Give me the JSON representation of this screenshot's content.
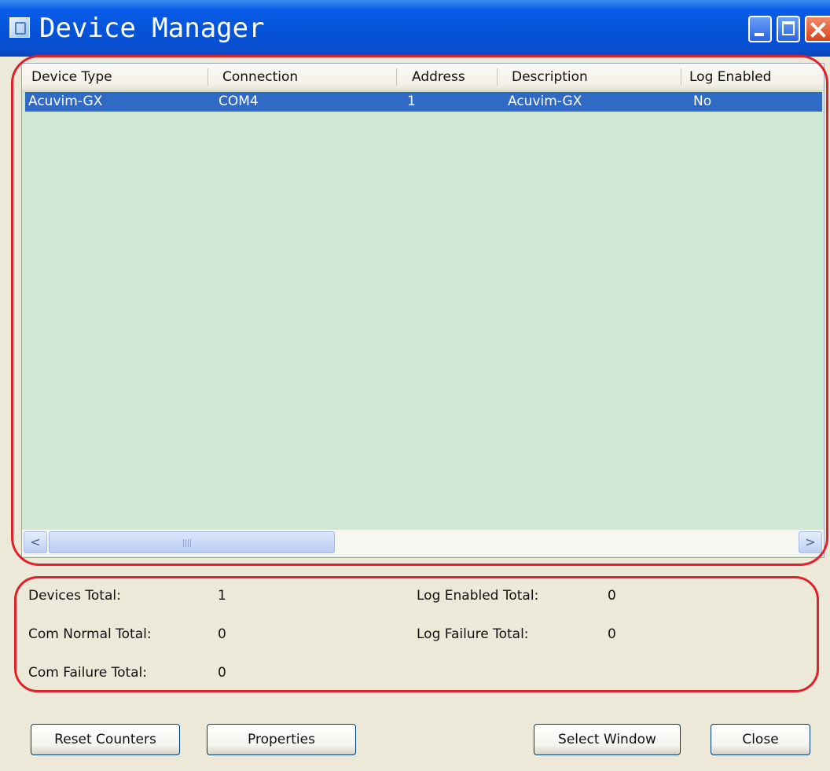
{
  "window": {
    "title": "Device Manager"
  },
  "device_list": {
    "columns": [
      "Device Type",
      "Connection",
      "Address",
      "Description",
      "Log Enabled"
    ],
    "rows": [
      [
        "Acuvim-GX",
        "COM4",
        "1",
        "Acuvim-GX",
        "No"
      ]
    ],
    "selected_row": 0,
    "scrollbar": {
      "left_arrow": "<",
      "right_arrow": ">"
    }
  },
  "stats": {
    "devices_total_label": "Devices Total:",
    "devices_total_value": "1",
    "com_normal_label": "Com Normal Total:",
    "com_normal_value": "0",
    "com_failure_label": "Com Failure Total:",
    "com_failure_value": "0",
    "log_enabled_label": "Log Enabled Total:",
    "log_enabled_value": "0",
    "log_failure_label": "Log Failure Total:",
    "log_failure_value": "0"
  },
  "buttons": {
    "reset_counters": "Reset Counters",
    "properties": "Properties",
    "select_window": "Select Window",
    "close": "Close"
  },
  "colors": {
    "selection": "#316ac5",
    "list_background": "#cfe8d3",
    "highlight_outline": "#e0202a",
    "window_face": "#ece9d8"
  }
}
